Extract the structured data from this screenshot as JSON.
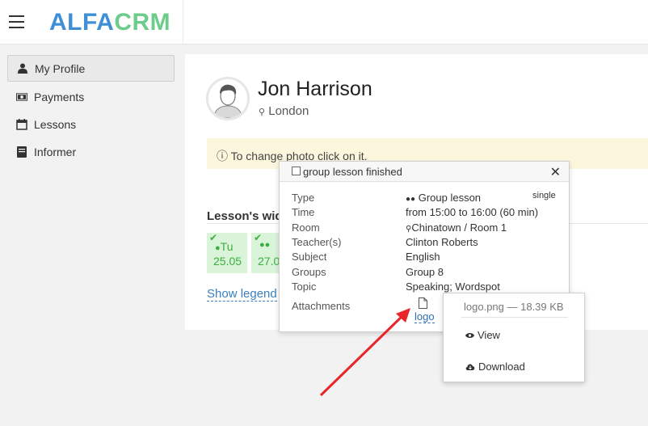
{
  "brand": {
    "part1": "ALFA",
    "part2": "CRM"
  },
  "sidebar": {
    "items": [
      {
        "label": "My Profile",
        "icon": "user-icon"
      },
      {
        "label": "Payments",
        "icon": "money-icon"
      },
      {
        "label": "Lessons",
        "icon": "calendar-icon"
      },
      {
        "label": "Informer",
        "icon": "book-icon"
      }
    ]
  },
  "profile": {
    "name": "Jon Harrison",
    "city": "London"
  },
  "notice": "ⓘ To change photo click on it.",
  "widget": {
    "title": "Lesson's wid",
    "days": [
      {
        "dow": "Tu",
        "date": "25.05"
      },
      {
        "dow": "",
        "date": "27.0"
      }
    ],
    "show_legend": "Show legend"
  },
  "popup": {
    "title": "group lesson finished",
    "badge": "single",
    "rows": [
      {
        "label": "Type",
        "value": "Group lesson"
      },
      {
        "label": "Time",
        "value": "from 15:00 to 16:00 (60 min)"
      },
      {
        "label": "Room",
        "value": "Chinatown / Room 1"
      },
      {
        "label": "Teacher(s)",
        "value": "Clinton Roberts"
      },
      {
        "label": "Subject",
        "value": "English"
      },
      {
        "label": "Groups",
        "value": "Group 8"
      },
      {
        "label": "Topic",
        "value": "Speaking; Wordspot"
      },
      {
        "label": "Attachments",
        "value": ""
      }
    ],
    "attachment_link": "logo"
  },
  "dropdown": {
    "file": "logo.png — 18.39 KB",
    "view": "View",
    "download": "Download"
  },
  "colors": {
    "brand_blue": "#3f8fd6",
    "brand_green": "#6dcc8a",
    "arrow": "#e8262a",
    "accent_link": "#2c6fb3"
  }
}
